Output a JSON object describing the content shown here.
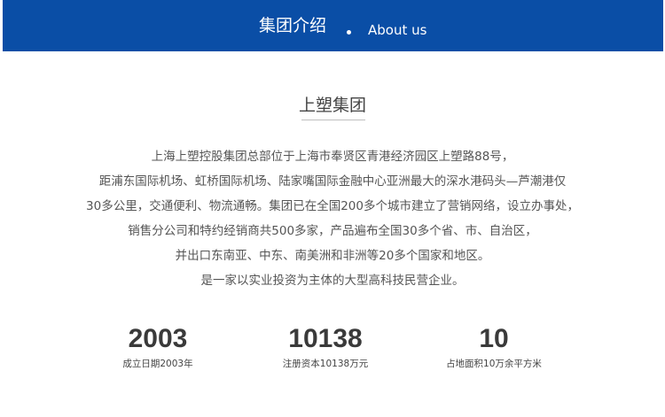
{
  "banner": {
    "title": "集团介绍",
    "subtitle": "About  us"
  },
  "section": {
    "title": "上塑集团"
  },
  "intro": {
    "lines": [
      "上海上塑控股集团总部位于上海市奉贤区青港经济园区上塑路88号，",
      "距浦东国际机场、虹桥国际机场、陆家嘴国际金融中心亚洲最大的深水港码头—芦潮港仅",
      "30多公里，交通便利、物流通畅。集团已在全国200多个城市建立了营销网络，设立办事处，",
      "销售分公司和特约经销商共500多家，产品遍布全国30多个省、市、自治区，",
      "并出口东南亚、中东、南美洲和非洲等20多个国家和地区。",
      "是一家以实业投资为主体的大型高科技民营企业。"
    ]
  },
  "stats": [
    {
      "value": "2003",
      "label": "成立日期2003年"
    },
    {
      "value": "10138",
      "label": "注册资本10138万元"
    },
    {
      "value": "10",
      "label": "占地面积10万余平方米"
    }
  ],
  "colors": {
    "banner_background": "#0a4ea6",
    "banner_text": "#ffffff"
  }
}
